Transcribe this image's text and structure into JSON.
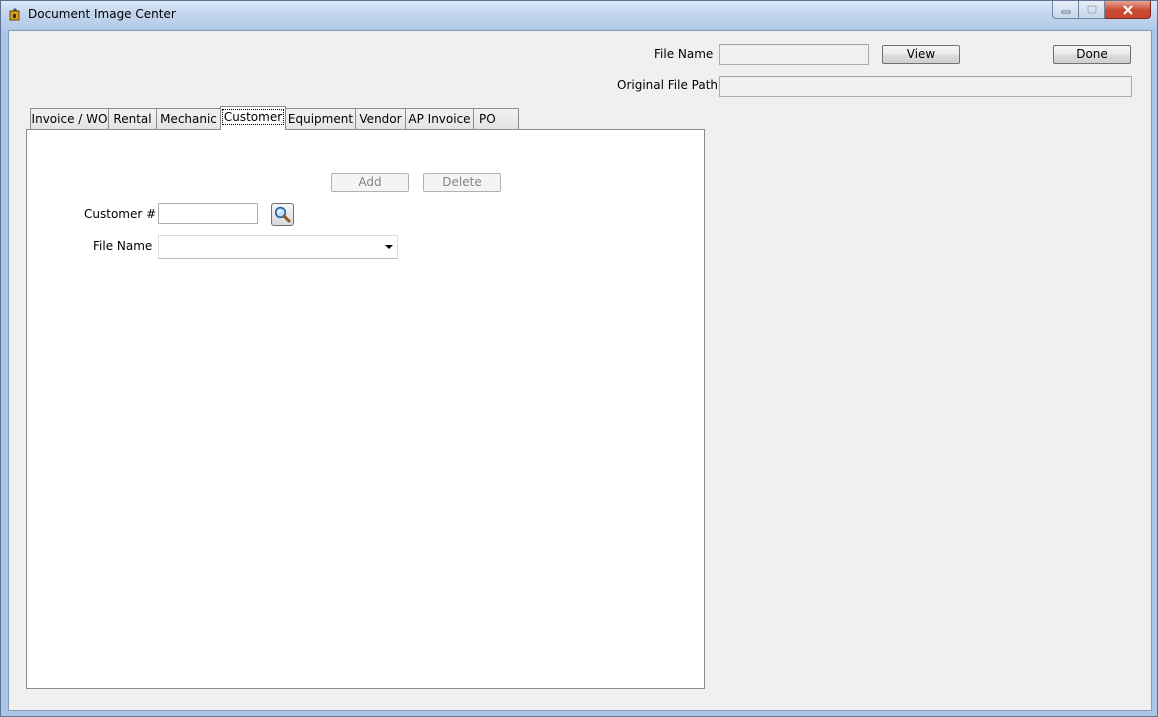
{
  "window": {
    "title": "Document Image Center"
  },
  "header": {
    "file_name_label": "File Name",
    "file_name_value": "",
    "view_button": "View",
    "done_button": "Done",
    "original_path_label": "Original File Path",
    "original_path_value": ""
  },
  "tabs": [
    {
      "label": "Invoice / WO"
    },
    {
      "label": "Rental"
    },
    {
      "label": "Mechanic"
    },
    {
      "label": "Customer",
      "active": true
    },
    {
      "label": "Equipment"
    },
    {
      "label": "Vendor"
    },
    {
      "label": "AP Invoice"
    },
    {
      "label": "PO"
    }
  ],
  "customer_tab": {
    "add_button": "Add",
    "delete_button": "Delete",
    "customer_label": "Customer #",
    "customer_value": "",
    "file_name_label": "File Name",
    "file_name_selected": ""
  },
  "icons": {
    "app": "app-icon",
    "lookup": "magnifier-search-icon"
  },
  "colors": {
    "titlebar": "#c3d6ee",
    "close_button": "#c94a31",
    "panel": "#ffffff",
    "client_bg": "#f0f0f0"
  }
}
